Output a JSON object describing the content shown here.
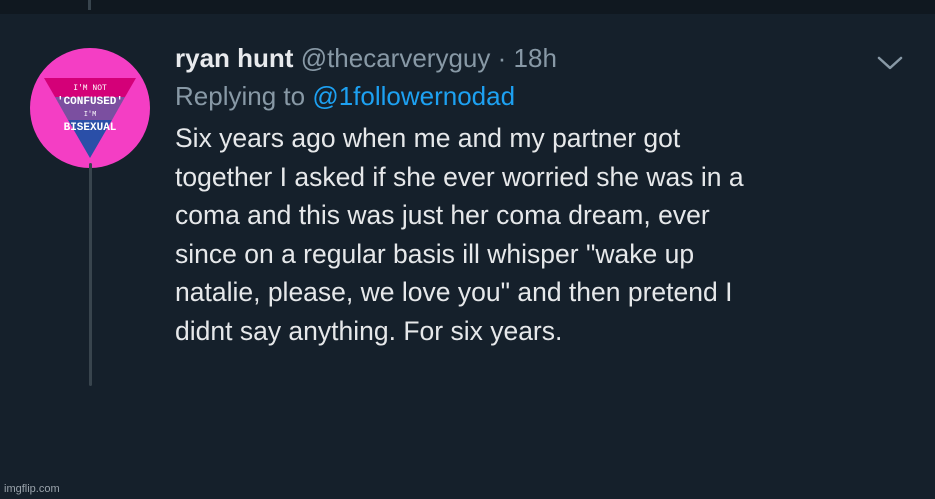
{
  "tweet": {
    "display_name": "ryan hunt",
    "handle": "@thecarveryguy",
    "separator": "·",
    "time": "18h",
    "reply_prefix": "Replying to",
    "reply_to": "@1followernodad",
    "body_lines": [
      "Six years ago when me and my partner got",
      "together I asked if she ever worried she was in a",
      "coma and this was just her coma dream, ever",
      "since on a regular basis ill whisper \"wake up",
      "natalie, please, we love you\" and then pretend I",
      "didnt say anything. For six years."
    ],
    "avatar_text": {
      "line1": "I'M NOT",
      "line2": "'CONFUSED'",
      "line3": "I'M",
      "line4": "BISEXUAL"
    }
  },
  "icons": {
    "more": "chevron-down-icon"
  },
  "watermark": "imgflip.com",
  "colors": {
    "background": "#15202b",
    "text": "#e6e8ea",
    "secondary": "#8899a6",
    "link": "#1da1f2",
    "avatar_pink": "#f43ec4",
    "flag_purple": "#7b4fa0",
    "flag_blue": "#2a4fa8"
  }
}
